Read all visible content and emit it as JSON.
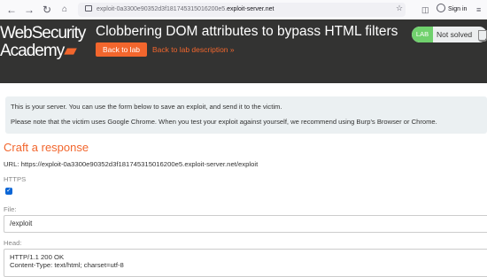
{
  "browser": {
    "url_prefix": "exploit-0a3300e90352d3f181745315016200e5.",
    "url_domain": "exploit-server.net",
    "sign_in": "Sign in"
  },
  "header": {
    "logo_line1": "WebSecurity",
    "logo_line2": "Academy",
    "title": "Clobbering DOM attributes to bypass HTML filters",
    "back_to_lab": "Back to lab",
    "back_to_description": "Back to lab description",
    "status_badge": "LAB",
    "status_text": "Not solved"
  },
  "notice": {
    "line1": "This is your server. You can use the form below to save an exploit, and send it to the victim.",
    "line2": "Please note that the victim uses Google Chrome. When you test your exploit against yourself, we recommend using Burp's Browser or Chrome."
  },
  "form": {
    "heading": "Craft a response",
    "url_label": "URL: https://exploit-0a3300e90352d3f181745315016200e5.exploit-server.net/exploit",
    "https_label": "HTTPS",
    "https_checked": true,
    "file_label": "File:",
    "file_value": "/exploit",
    "head_label": "Head:",
    "head_line1": "HTTP/1.1 200 OK",
    "head_line2": "Content-Type: text/html; charset=utf-8"
  },
  "colors": {
    "accent": "#f2662d",
    "header_bg": "#333332",
    "status_green": "#70d16d",
    "notice_bg": "#ebf0f2"
  }
}
